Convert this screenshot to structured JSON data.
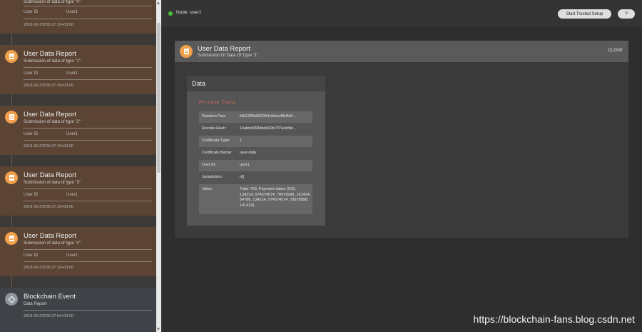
{
  "timeline": {
    "top_partial": {
      "sub": "Submission of data of type \"0\"",
      "user_id_label": "User ID",
      "user_id_value": "User1",
      "timestamp": "2018-06-23T05:37:10+03:00"
    },
    "cards": [
      {
        "title": "User Data Report",
        "subtitle": "Submission of data of type \"1\"",
        "user_id_label": "User ID",
        "user_id_value": "User1",
        "timestamp": "2018-06-23T05:37:10+03:00"
      },
      {
        "title": "User Data Report",
        "subtitle": "Submission of data of type \"2\"",
        "user_id_label": "User ID",
        "user_id_value": "User1",
        "timestamp": "2018-06-23T05:37:10+03:00"
      },
      {
        "title": "User Data Report",
        "subtitle": "Submission of data of type \"3\"",
        "user_id_label": "User ID",
        "user_id_value": "User1",
        "timestamp": "2018-06-23T05:37:10+03:00"
      },
      {
        "title": "User Data Report",
        "subtitle": "Submission of data of type \"4\"",
        "user_id_label": "User ID",
        "user_id_value": "User1",
        "timestamp": "2018-06-23T05:37:10+03:00"
      },
      {
        "title": "Blockchain Event",
        "subtitle": "Data Report",
        "timestamp": "2018-06-23T05:37:54+03:00"
      }
    ]
  },
  "topbar": {
    "node_label": "Node: user1",
    "trusted_setup_label": "Start Trusted Setup",
    "help_label": "?"
  },
  "panel": {
    "title": "User Data Report",
    "subtitle": "Submission Of Data Of Type \"1\"",
    "close_label": "CLOSE",
    "data_title": "Data",
    "private_data_label": "Private Data",
    "rows": [
      {
        "key": "Random Two:",
        "value": "fd612ff5b552094c0dee4fb4fc8..."
      },
      {
        "key": "Revoke Hash:",
        "value": "16abbd068dbdd29b797a4efde..."
      },
      {
        "key": "Certificate Type:",
        "value": "1"
      },
      {
        "key": "Certificate Name:",
        "value": "user-data"
      },
      {
        "key": "User ID:",
        "value": "user1"
      },
      {
        "key": "Jurisdiction:",
        "value": "n[]"
      },
      {
        "key": "Value:",
        "value": "Total: 760, Payment dates: [533, 134214, 574574574, 78978998, 141414, 54786, 134214, 574574574, 78978998, 141414]"
      }
    ]
  },
  "watermark": "https://blockchain-fans.blog.csdn.net",
  "colors": {
    "accent_orange": "#f0a04a",
    "private_red": "#e26c55",
    "status_green": "#49c43a"
  }
}
